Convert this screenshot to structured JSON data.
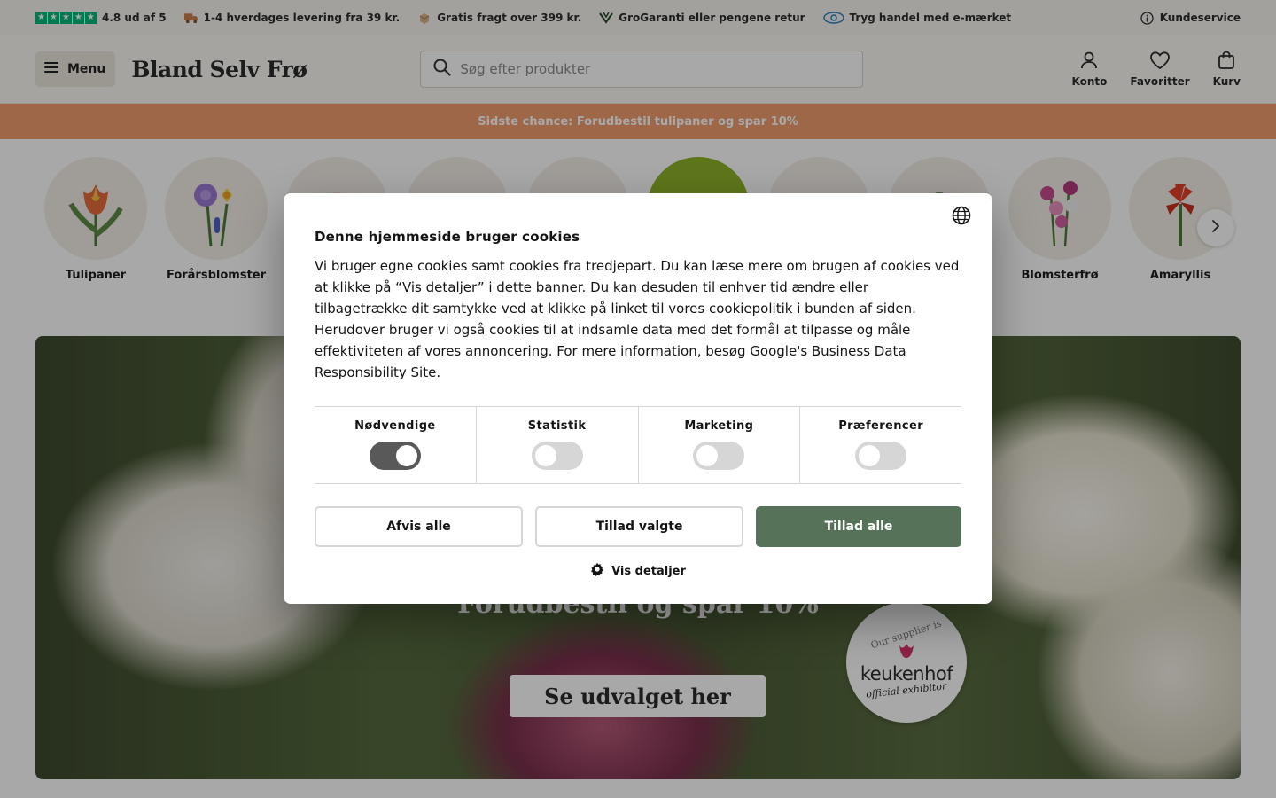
{
  "usp_bar": {
    "rating": "4.8 ud af 5",
    "delivery": "1-4 hverdages levering fra 39 kr.",
    "free_shipping": "Gratis fragt over 399 kr.",
    "guarantee": "GroGaranti eller pengene retur",
    "trust": "Tryg handel med e-mærket",
    "customer_service": "Kundeservice",
    "colors": {
      "trustpilot": "#00b67a"
    }
  },
  "header": {
    "menu_label": "Menu",
    "logo_text": "Bland Selv Frø",
    "search_placeholder": "Søg efter produkter",
    "actions": {
      "account": "Konto",
      "favorites": "Favoritter",
      "cart": "Kurv"
    }
  },
  "promo": {
    "text": "Sidste chance: Forudbestil tulipaner og spar 10%",
    "color": "#f09d6c"
  },
  "categories": [
    {
      "label": "Tulipaner",
      "icon": "tulip-icon"
    },
    {
      "label": "Forårsblomster",
      "icon": "crocus-icon"
    },
    {
      "label": "",
      "icon": "flower-icon"
    },
    {
      "label": "",
      "icon": "seed-icon"
    },
    {
      "label": "",
      "icon": "bulb-icon"
    },
    {
      "label": "",
      "icon": "plant-icon"
    },
    {
      "label": "",
      "icon": "sprout-icon"
    },
    {
      "label": "",
      "icon": "herb-icon"
    },
    {
      "label": "Blomsterfrø",
      "icon": "orchid-icon"
    },
    {
      "label": "Amaryllis",
      "icon": "amaryllis-icon"
    }
  ],
  "hero": {
    "title": "Forudbestil og spar 10%",
    "cta": "Se udvalget her",
    "badge": {
      "top": "Our supplier is",
      "brand": "keukenhof",
      "bottom": "official exhibitor"
    }
  },
  "cookie_dialog": {
    "title": "Denne hjemmeside bruger cookies",
    "paragraph_1": "Vi bruger egne cookies samt cookies fra tredjepart. Du kan læse mere om brugen af cookies ved at klikke på “Vis detaljer” i dette banner. Du kan desuden til enhver tid ændre eller tilbagetrække dit samtykke ved at klikke på linket til vores cookiepolitik i bunden af siden.",
    "paragraph_2": "Herudover bruger vi også cookies til at indsamle data med det formål at tilpasse og måle effektiviteten af vores annoncering. For mere information, besøg Google's Business Data Responsibility Site.",
    "toggles": [
      {
        "label": "Nødvendige",
        "on": true,
        "disabled": true
      },
      {
        "label": "Statistik",
        "on": false,
        "disabled": false
      },
      {
        "label": "Marketing",
        "on": false,
        "disabled": false
      },
      {
        "label": "Præferencer",
        "on": false,
        "disabled": false
      }
    ],
    "buttons": {
      "reject": "Afvis alle",
      "allow_selected": "Tillad valgte",
      "allow_all": "Tillad alle"
    },
    "details_link": "Vis detaljer",
    "colors": {
      "accent": "#567359"
    }
  }
}
